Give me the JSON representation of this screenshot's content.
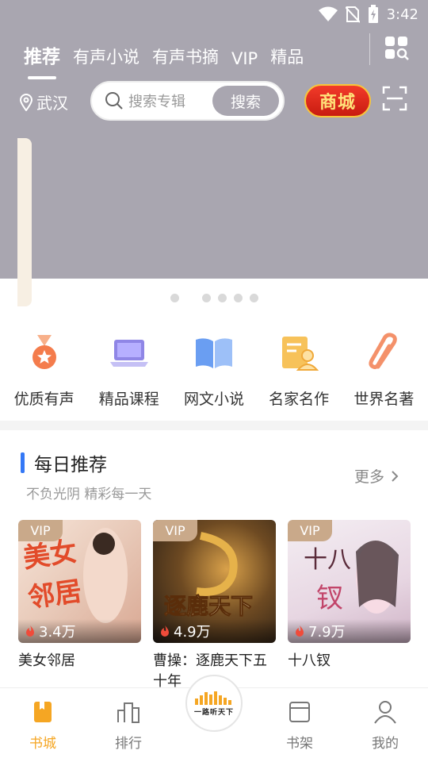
{
  "status_bar": {
    "time": "3:42"
  },
  "tabs": [
    {
      "label": "推荐"
    },
    {
      "label": "有声小说"
    },
    {
      "label": "有声书摘"
    },
    {
      "label": "VIP"
    },
    {
      "label": "精品"
    }
  ],
  "location": "武汉",
  "search": {
    "placeholder": "搜索专辑",
    "button": "搜索"
  },
  "mall_label": "商城",
  "categories": [
    {
      "label": "优质有声",
      "icon": "medal-icon"
    },
    {
      "label": "精品课程",
      "icon": "laptop-icon"
    },
    {
      "label": "网文小说",
      "icon": "book-icon"
    },
    {
      "label": "名家名作",
      "icon": "author-icon"
    },
    {
      "label": "世界名著",
      "icon": "clip-icon"
    }
  ],
  "daily": {
    "title": "每日推荐",
    "subtitle": "不负光阴 精彩每一天",
    "more": "更多"
  },
  "books": [
    {
      "title": "美女邻居",
      "plays": "3.4万",
      "tag": "VIP",
      "cover_text": "美女邻居"
    },
    {
      "title": "曹操：逐鹿天下五十年",
      "plays": "4.9万",
      "tag": "VIP",
      "cover_text": "逐鹿天下"
    },
    {
      "title": "十八钗",
      "plays": "7.9万",
      "tag": "VIP",
      "cover_text": "十八钗"
    }
  ],
  "nav": [
    {
      "label": "书城"
    },
    {
      "label": "排行"
    },
    {
      "label": "书架"
    },
    {
      "label": "我的"
    }
  ],
  "center_logo_text": "一路听天下",
  "colors": {
    "header_bg": "#a9a6b0",
    "accent": "#f5a623",
    "section_bar": "#3478f6",
    "vip_tag": "#c9a98a"
  }
}
